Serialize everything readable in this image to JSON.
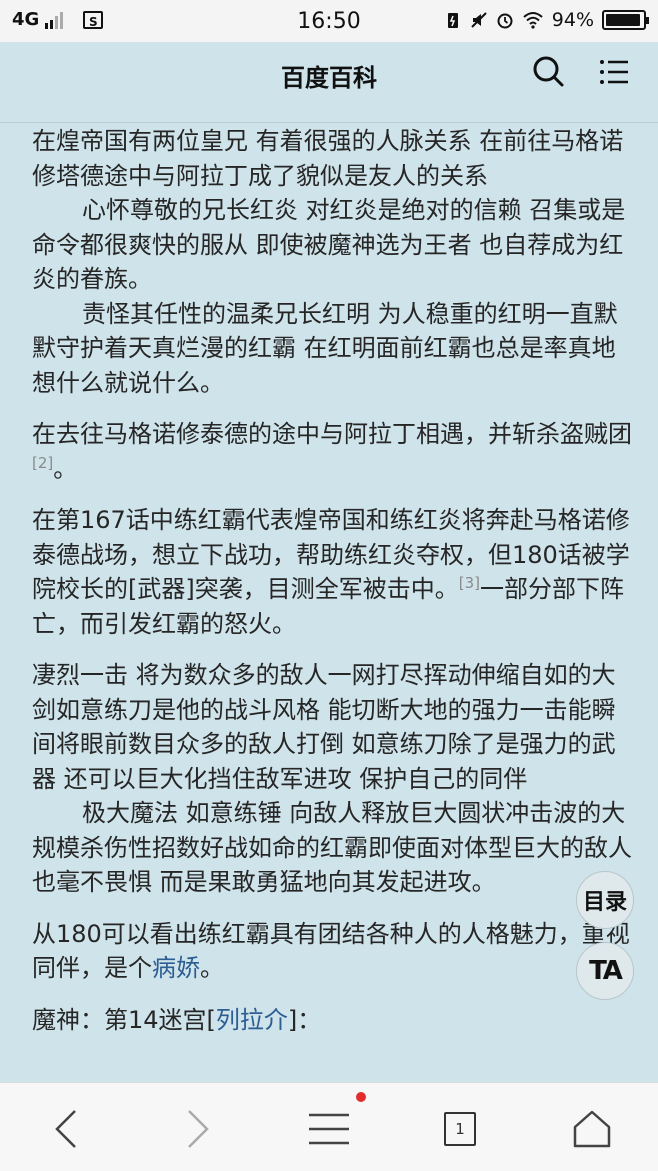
{
  "status_bar": {
    "network": "4G",
    "time": "16:50",
    "battery": "94%"
  },
  "header": {
    "title": "百度百科"
  },
  "article": {
    "p1": "在煌帝国有两位皇兄 有着很强的人脉关系 在前往马格诺修塔德途中与阿拉丁成了貌似是友人的关系",
    "p2": "心怀尊敬的兄长红炎 对红炎是绝对的信赖 召集或是命令都很爽快的服从 即使被魔神选为王者 也自荐成为红炎的眷族。",
    "p3": "责怪其任性的温柔兄长红明 为人稳重的红明一直默默守护着天真烂漫的红霸 在红明面前红霸也总是率真地想什么就说什么。",
    "p4_text": "在去往马格诺修泰德的途中与阿拉丁相遇，并斩杀盗贼团",
    "p4_ref": "[2]",
    "p4_end": "。",
    "p5_text": "在第167话中练红霸代表煌帝国和练红炎将奔赴马格诺修泰德战场，想立下战功，帮助练红炎夺权，但180话被学院校长的[武器]突袭，目测全军被击中。",
    "p5_ref": "[3]",
    "p5_end": "一部分部下阵亡，而引发红霸的怒火。",
    "p6": "凄烈一击 将为数众多的敌人一网打尽挥动伸缩自如的大剑如意练刀是他的战斗风格 能切断大地的强力一击能瞬间将眼前数目众多的敌人打倒 如意练刀除了是强力的武器 还可以巨大化挡住敌军进攻 保护自己的同伴",
    "p7": "极大魔法 如意练锤 向敌人释放巨大圆状冲击波的大规模杀伤性招数好战如命的红霸即使面对体型巨大的敌人也毫不畏惧 而是果敢勇猛地向其发起进攻。",
    "p8_text": "从180可以看出练红霸具有团结各种人的人格魅力，重视同伴，是个",
    "p8_link": "病娇",
    "p8_end": "。",
    "p9_text": "魔神：第14迷宫[",
    "p9_link": "列拉介",
    "p9_end": "]："
  },
  "floating": {
    "toc_label": "目录",
    "ta_label": "TA"
  },
  "bottom_nav": {
    "tab_count": "1"
  }
}
